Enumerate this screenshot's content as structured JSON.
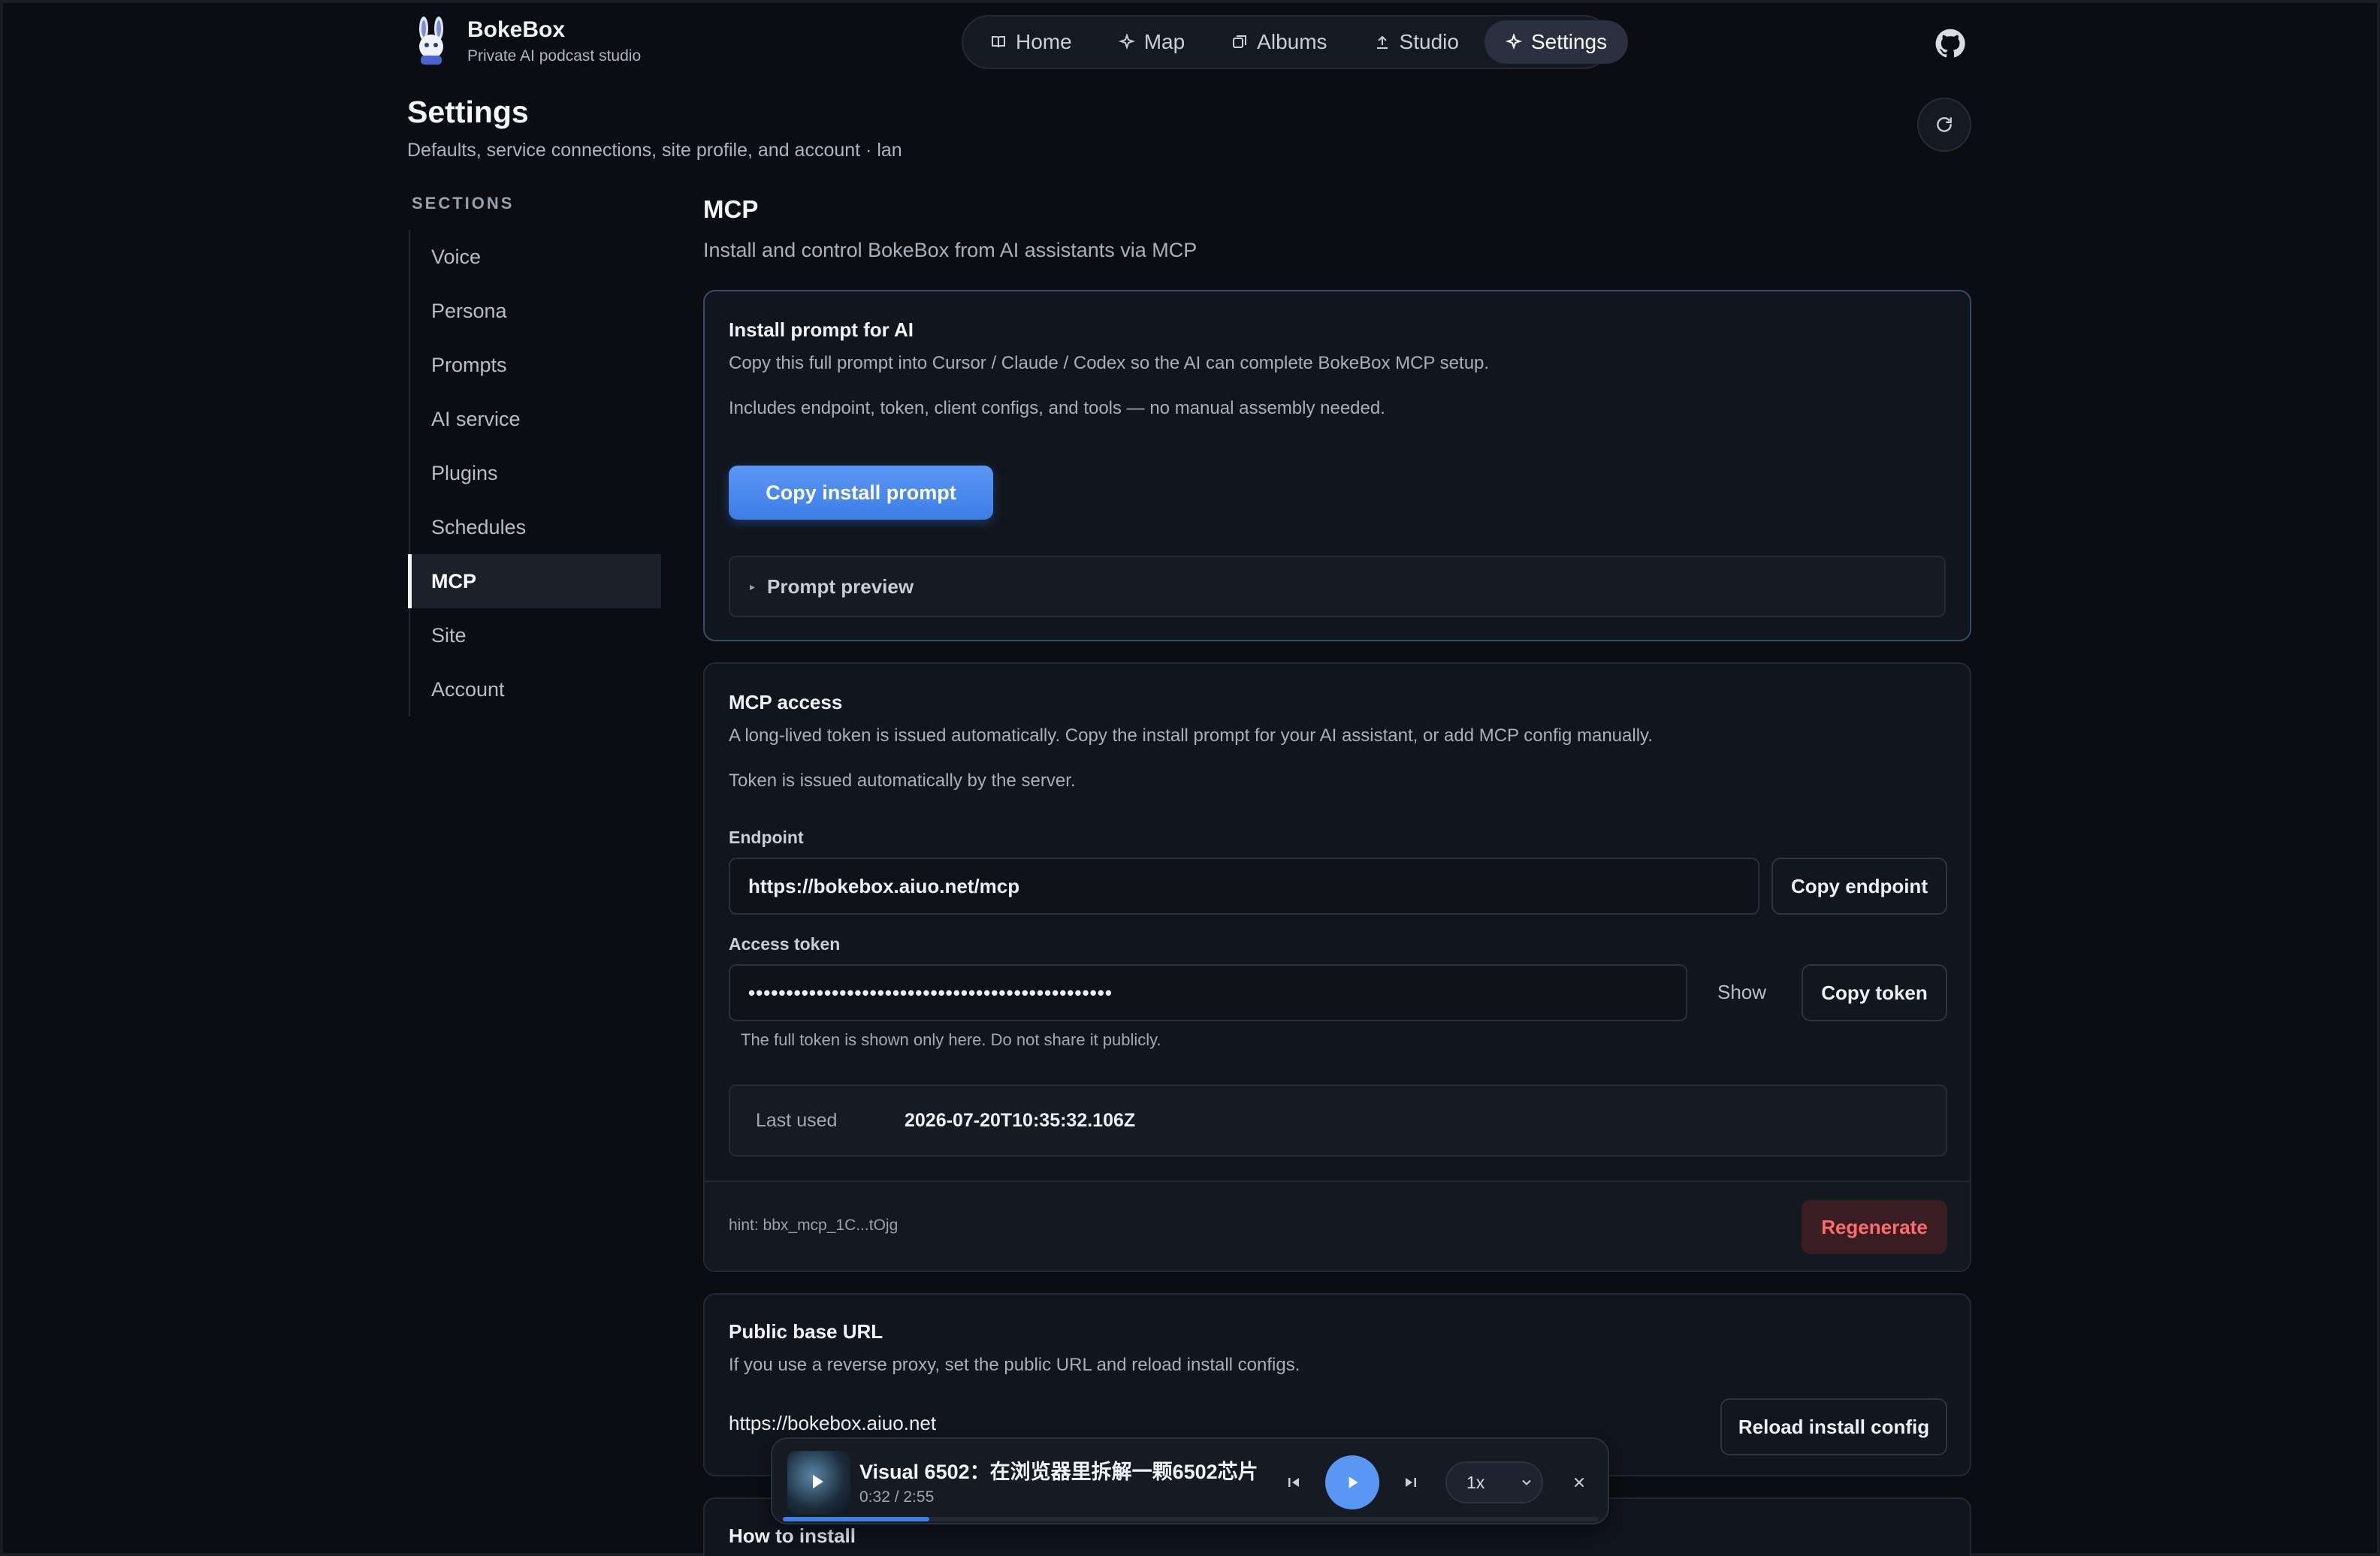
{
  "brand": {
    "name": "BokeBox",
    "tagline": "Private AI podcast studio"
  },
  "nav": [
    {
      "label": "Home",
      "icon": "book-icon"
    },
    {
      "label": "Map",
      "icon": "sparkle-map-icon"
    },
    {
      "label": "Albums",
      "icon": "albums-icon"
    },
    {
      "label": "Studio",
      "icon": "upload-icon"
    },
    {
      "label": "Settings",
      "icon": "sparkle-icon",
      "active": true
    }
  ],
  "page": {
    "title": "Settings",
    "subtitle": "Defaults, service connections, site profile, and account · lan"
  },
  "sidebar": {
    "heading": "SECTIONS",
    "items": [
      {
        "label": "Voice"
      },
      {
        "label": "Persona"
      },
      {
        "label": "Prompts"
      },
      {
        "label": "AI service"
      },
      {
        "label": "Plugins"
      },
      {
        "label": "Schedules"
      },
      {
        "label": "MCP",
        "active": true
      },
      {
        "label": "Site"
      },
      {
        "label": "Account"
      }
    ]
  },
  "main": {
    "title": "MCP",
    "subtitle": "Install and control BokeBox from AI assistants via MCP"
  },
  "install_card": {
    "title": "Install prompt for AI",
    "text1": "Copy this full prompt into Cursor / Claude / Codex so the AI can complete BokeBox MCP setup.",
    "text2": "Includes endpoint, token, client configs, and tools — no manual assembly needed.",
    "button": "Copy install prompt",
    "preview_label": "Prompt preview"
  },
  "access_card": {
    "title": "MCP access",
    "text1": "A long-lived token is issued automatically. Copy the install prompt for your AI assistant, or add MCP config manually.",
    "text2": "Token is issued automatically by the server.",
    "endpoint_label": "Endpoint",
    "endpoint_value": "https://bokebox.aiuo.net/mcp",
    "copy_endpoint": "Copy endpoint",
    "token_label": "Access token",
    "token_value": "••••••••••••••••••••••••••••••••••••••••••••••••",
    "show_label": "Show",
    "copy_token": "Copy token",
    "token_note": "The full token is shown only here. Do not share it publicly.",
    "last_used_label": "Last used",
    "last_used_value": "2026-07-20T10:35:32.106Z",
    "hint": "hint: bbx_mcp_1C...tOjg",
    "regenerate": "Regenerate"
  },
  "public_card": {
    "title": "Public base URL",
    "text": "If you use a reverse proxy, set the public URL and reload install configs.",
    "url": "https://bokebox.aiuo.net",
    "reload": "Reload install config"
  },
  "howto_card": {
    "title": "How to install"
  },
  "player": {
    "title": "Visual 6502：在浏览器里拆解一颗6502芯片",
    "time": "0:32 / 2:55",
    "progress": 0.18,
    "speed": "1x"
  },
  "colors": {
    "accent": "#3d7de6",
    "danger": "#ff6b6b",
    "background": "#0b0d12"
  }
}
